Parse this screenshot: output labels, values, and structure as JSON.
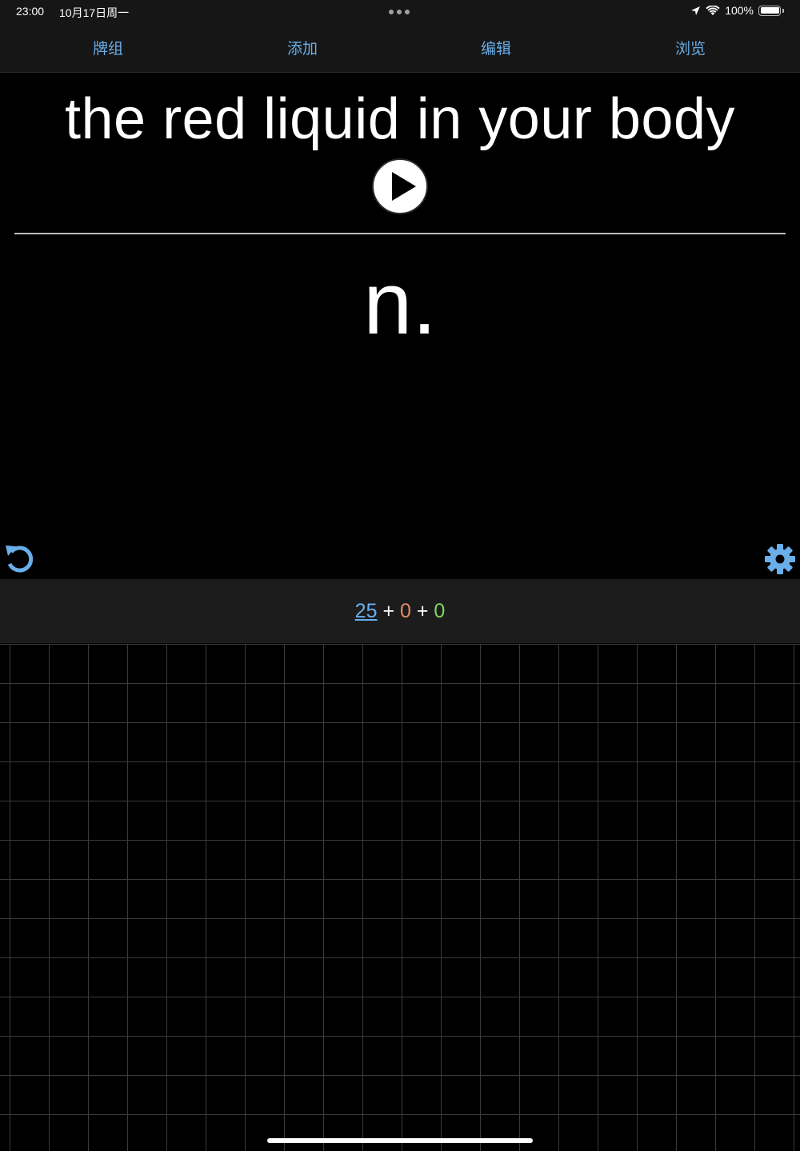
{
  "status_bar": {
    "time": "23:00",
    "date": "10月17日周一",
    "battery": "100%",
    "icons": [
      "location-arrow-icon",
      "wifi-icon",
      "battery-icon"
    ]
  },
  "nav": {
    "decks_label": "牌组",
    "add_label": "添加",
    "edit_label": "编辑",
    "browse_label": "浏览"
  },
  "card": {
    "question": "the red liquid in your body",
    "answer": "n."
  },
  "counts": {
    "new": "25",
    "plus1": "+",
    "learning": "0",
    "plus2": "+",
    "review": "0"
  },
  "colors": {
    "accent": "#6aaeea",
    "learning": "#e38d63",
    "review": "#7fd65d",
    "background": "#000000",
    "bar": "#1c1c1c"
  },
  "icons": {
    "play": "play-icon",
    "undo": "undo-icon",
    "settings": "gear-icon"
  }
}
